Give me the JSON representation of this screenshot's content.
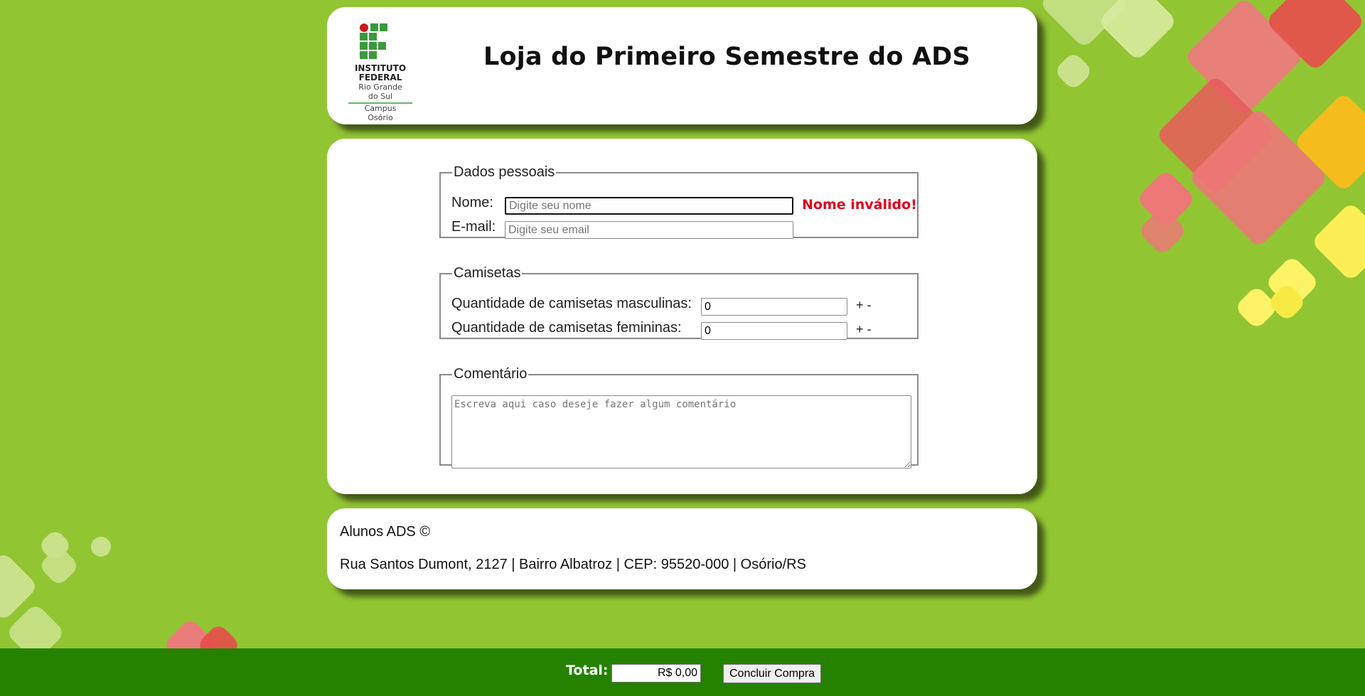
{
  "header": {
    "title": "Loja do Primeiro Semestre do ADS",
    "logo": {
      "line1": "INSTITUTO",
      "line2": "FEDERAL",
      "line3": "Rio Grande",
      "line4": "do Sul",
      "line5": "Campus",
      "line6": "Osório"
    }
  },
  "dados_pessoais": {
    "legend": "Dados pessoais",
    "nome_label": "Nome:",
    "nome_placeholder": "Digite seu nome",
    "nome_value": "",
    "nome_error": "Nome inválido!",
    "email_label": "E-mail:",
    "email_placeholder": "Digite seu email",
    "email_value": ""
  },
  "camisetas": {
    "legend": "Camisetas",
    "masc_label": "Quantidade de camisetas masculinas:",
    "masc_value": "0",
    "fem_label": "Quantidade de camisetas femininas:",
    "fem_value": "0",
    "plus": "+",
    "minus": "-"
  },
  "comentario": {
    "legend": "Comentário",
    "placeholder": "Escreva aqui caso deseje fazer algum comentário"
  },
  "footer": {
    "line1": "Alunos ADS ©",
    "line2": "Rua Santos Dumont, 2127 | Bairro Albatroz | CEP: 95520-000 | Osório/RS"
  },
  "bottom_bar": {
    "total_label": "Total:",
    "total_value": "R$ 0,00",
    "submit_label": "Concluir Compra"
  },
  "colors": {
    "background": "#92c532",
    "bottom_bar": "#258201",
    "error": "#e0001b",
    "logo_green": "#3b9a3b",
    "logo_red": "#c8191f"
  }
}
